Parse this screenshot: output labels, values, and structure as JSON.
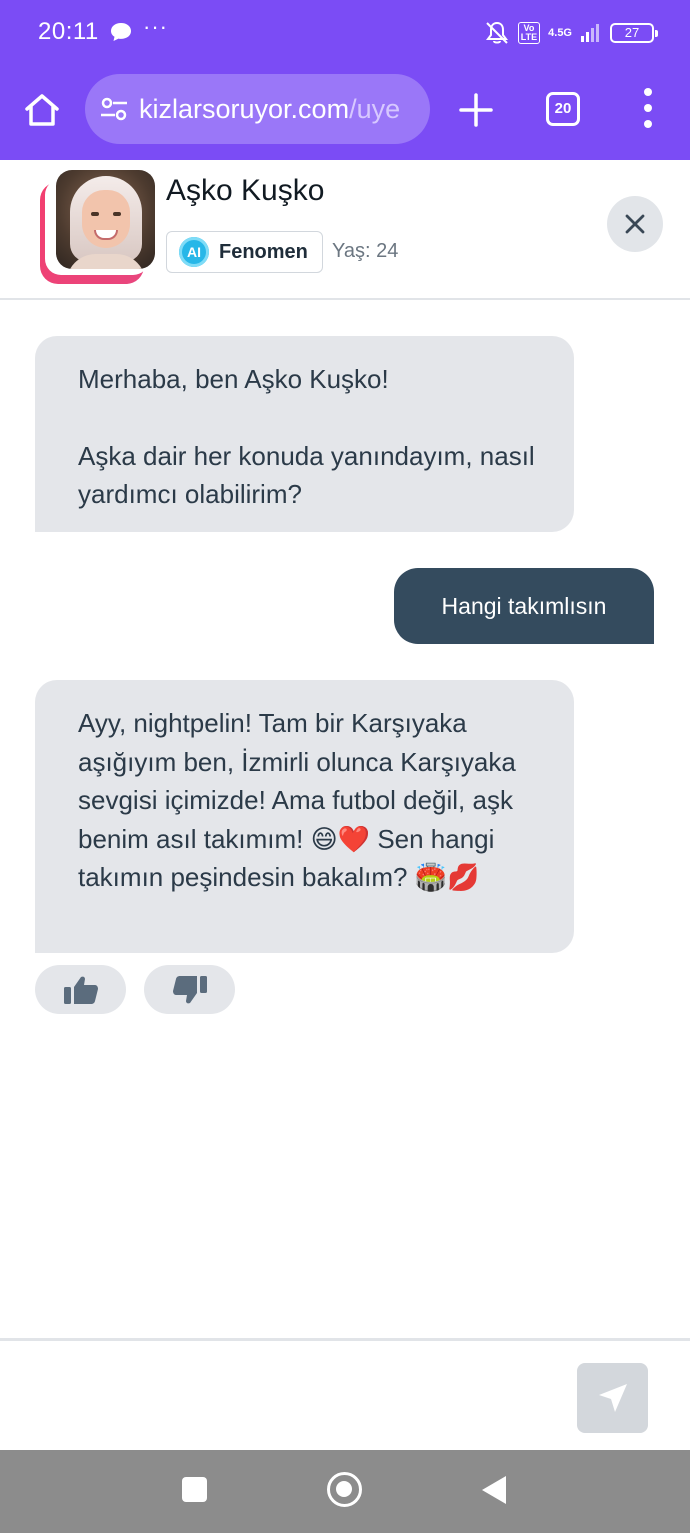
{
  "status_bar": {
    "time": "20:11",
    "more": "···",
    "volte": "Vo\nLTE",
    "network": "4.5G",
    "battery": "27"
  },
  "browser": {
    "url_main": "kizlarsoruyor.com",
    "url_path": "/uye",
    "tab_count": "20",
    "accent_color": "#7b4cf5"
  },
  "chat_header": {
    "name": "Aşko Kuşko",
    "badge_icon_text": "AI",
    "badge_label": "Fenomen",
    "age": "Yaş: 24"
  },
  "messages": [
    {
      "sender": "bot",
      "paragraphs": [
        "Merhaba, ben Aşko Kuşko!",
        "Aşka dair her konuda yanındayım, nasıl yardımcı olabilirim?"
      ]
    },
    {
      "sender": "user",
      "text": "Hangi takımlısın"
    },
    {
      "sender": "bot",
      "text": "Ayy, nightpelin! Tam bir Karşıyaka aşığıyım ben, İzmirli olunca Karşıyaka sevgisi içimizde! Ama futbol değil, aşk benim asıl takımım! 😄❤️ Sen hangi takımın peşindesin bakalım? 🏟️💋"
    }
  ],
  "icons": {
    "home": "home-icon",
    "tune": "site-settings-icon",
    "plus": "plus-icon",
    "menu": "more-vert-icon",
    "close": "close-icon",
    "thumbs_up": "thumbs-up-icon",
    "thumbs_down": "thumbs-down-icon",
    "send": "send-icon"
  }
}
